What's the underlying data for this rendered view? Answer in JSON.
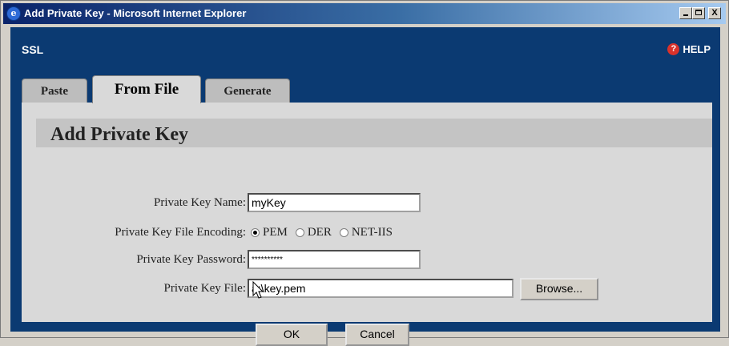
{
  "window": {
    "title": "Add Private Key - Microsoft Internet Explorer",
    "controls": {
      "minimize": "_",
      "maximize": "□",
      "close": "X"
    }
  },
  "header": {
    "section": "SSL",
    "help_label": "HELP",
    "help_icon": "question-icon"
  },
  "tabs": [
    {
      "label": "Paste",
      "active": false
    },
    {
      "label": "From File",
      "active": true
    },
    {
      "label": "Generate",
      "active": false
    }
  ],
  "form": {
    "title": "Add Private Key",
    "key_name": {
      "label": "Private Key Name:",
      "value": "myKey"
    },
    "encoding": {
      "label": "Private Key File Encoding:",
      "options": [
        "PEM",
        "DER",
        "NET-IIS"
      ],
      "selected": "PEM"
    },
    "password": {
      "label": "Private Key Password:",
      "value": "**********"
    },
    "file": {
      "label": "Private Key File:",
      "value": "a:\\key.pem",
      "browse_label": "Browse..."
    },
    "ok_label": "OK",
    "cancel_label": "Cancel"
  },
  "colors": {
    "client_bg": "#0b3a72",
    "panel_bg": "#d9d9d9",
    "titlebar_start": "#0a246a"
  }
}
